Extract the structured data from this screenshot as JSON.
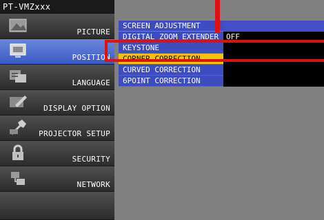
{
  "title": "PT-VMZxxx",
  "sidebar": {
    "items": [
      {
        "label": "PICTURE",
        "icon": "picture-icon",
        "active": false
      },
      {
        "label": "POSITION",
        "icon": "position-icon",
        "active": true
      },
      {
        "label": "LANGUAGE",
        "icon": "language-icon",
        "active": false
      },
      {
        "label": "DISPLAY OPTION",
        "icon": "display-option-icon",
        "active": false
      },
      {
        "label": "PROJECTOR SETUP",
        "icon": "projector-setup-icon",
        "active": false
      },
      {
        "label": "SECURITY",
        "icon": "padlock-icon",
        "active": false
      },
      {
        "label": "NETWORK",
        "icon": "network-icon",
        "active": false
      }
    ]
  },
  "menu": {
    "rows": [
      {
        "label": "SCREEN ADJUSTMENT",
        "value": ""
      },
      {
        "label": "DIGITAL ZOOM EXTENDER",
        "value": "OFF"
      },
      {
        "label": "KEYSTONE",
        "value": ""
      },
      {
        "label": "CORNER CORRECTION",
        "value": "",
        "selected": true
      },
      {
        "label": "CURVED CORRECTION",
        "value": ""
      },
      {
        "label": "6POINT CORRECTION",
        "value": ""
      }
    ]
  },
  "colors": {
    "highlight": "#e01010",
    "selection": "#f5c400",
    "menu_blue": "#3d4cc0",
    "active_tab": "#4a6ad0"
  }
}
